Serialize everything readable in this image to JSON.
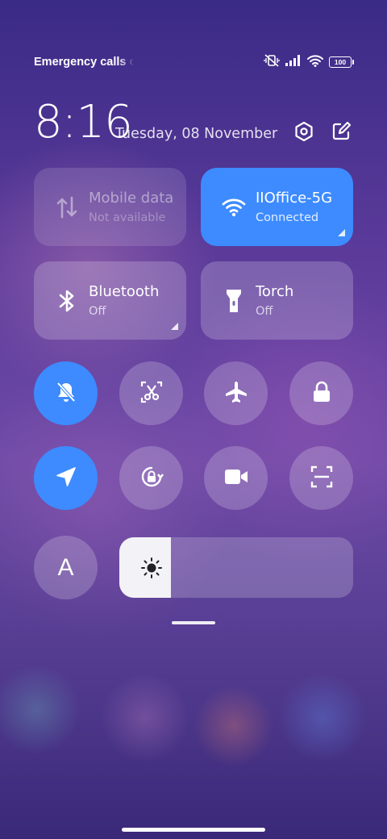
{
  "status_bar": {
    "carrier_text": "Emergency calls o",
    "battery": "100",
    "icons": [
      "mute-vibrate-icon",
      "signal-icon",
      "wifi-icon",
      "battery-icon"
    ]
  },
  "header": {
    "time": "8:16",
    "date": "Tuesday, 08 November",
    "settings_icon": "settings-hex-icon",
    "edit_icon": "edit-icon"
  },
  "tiles": {
    "mobile_data": {
      "title": "Mobile data",
      "subtitle": "Not available",
      "state": "disabled"
    },
    "wifi": {
      "title": "IIOffice-5G",
      "subtitle": "Connected",
      "state": "on"
    },
    "bluetooth": {
      "title": "Bluetooth",
      "subtitle": "Off",
      "state": "off"
    },
    "torch": {
      "title": "Torch",
      "subtitle": "Off",
      "state": "off"
    }
  },
  "toggles": [
    {
      "name": "silent",
      "icon": "bell-off-icon",
      "on": true
    },
    {
      "name": "screenshot",
      "icon": "scissors-icon",
      "on": false
    },
    {
      "name": "airplane",
      "icon": "airplane-icon",
      "on": false
    },
    {
      "name": "lock",
      "icon": "lock-icon",
      "on": false
    },
    {
      "name": "location",
      "icon": "location-icon",
      "on": true
    },
    {
      "name": "rotation-lock",
      "icon": "rotation-lock-icon",
      "on": false
    },
    {
      "name": "screen-recorder",
      "icon": "video-camera-icon",
      "on": false
    },
    {
      "name": "scanner",
      "icon": "scan-icon",
      "on": false
    }
  ],
  "auto_brightness_label": "A",
  "brightness": {
    "level": 0.22
  },
  "colors": {
    "accent": "#3d8bff"
  }
}
